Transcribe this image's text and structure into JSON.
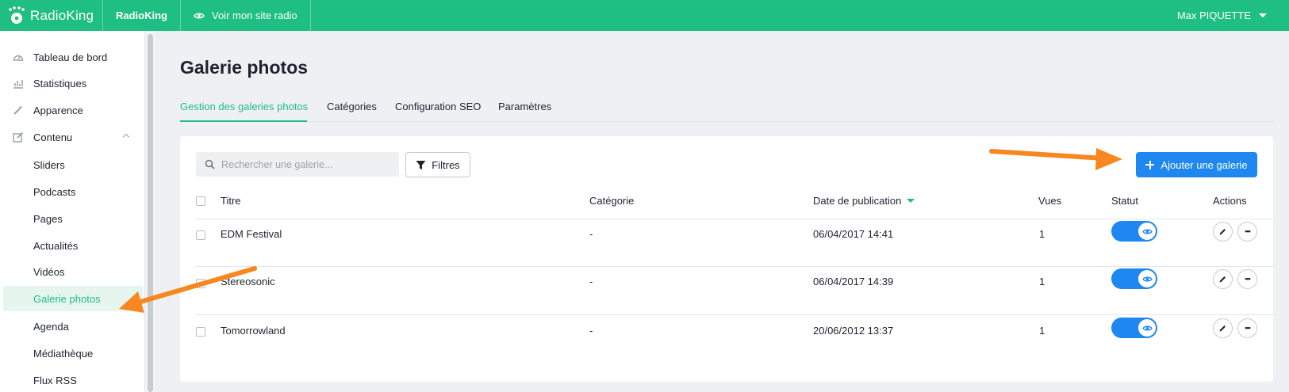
{
  "colors": {
    "brand": "#1fbe82",
    "primary": "#1e88f0",
    "annotation": "#f7871e"
  },
  "topbar": {
    "logo_text": "RadioKing",
    "station_name": "RadioKing",
    "view_site_label": "Voir mon site radio",
    "user_name": "Max PIQUETTE"
  },
  "sidebar": {
    "items": [
      {
        "label": "Tableau de bord",
        "icon": "gauge-icon"
      },
      {
        "label": "Statistiques",
        "icon": "bar-chart-icon"
      },
      {
        "label": "Apparence",
        "icon": "magic-wand-icon"
      },
      {
        "label": "Contenu",
        "icon": "edit-icon",
        "expanded": true
      },
      {
        "label": "Sliders"
      },
      {
        "label": "Podcasts"
      },
      {
        "label": "Pages"
      },
      {
        "label": "Actualités"
      },
      {
        "label": "Vidéos"
      },
      {
        "label": "Galerie photos",
        "active": true
      },
      {
        "label": "Agenda"
      },
      {
        "label": "Médiathèque"
      },
      {
        "label": "Flux RSS"
      }
    ]
  },
  "page": {
    "title": "Galerie photos"
  },
  "tabs": [
    {
      "label": "Gestion des galeries photos",
      "active": true
    },
    {
      "label": "Catégories"
    },
    {
      "label": "Configuration SEO"
    },
    {
      "label": "Paramètres"
    }
  ],
  "toolbar": {
    "search_placeholder": "Rechercher une galerie...",
    "filter_label": "Filtres",
    "add_label": "Ajouter une galerie"
  },
  "table": {
    "headers": {
      "title": "Titre",
      "category": "Catégorie",
      "date": "Date de publication",
      "views": "Vues",
      "status": "Statut",
      "actions": "Actions"
    },
    "sort": {
      "column": "date",
      "direction": "desc"
    },
    "rows": [
      {
        "title": "EDM Festival",
        "category": "-",
        "date": "06/04/2017 14:41",
        "views": "1",
        "published": true
      },
      {
        "title": "Stereosonic",
        "category": "-",
        "date": "06/04/2017 14:39",
        "views": "1",
        "published": true
      },
      {
        "title": "Tomorrowland",
        "category": "-",
        "date": "20/06/2012 13:37",
        "views": "1",
        "published": true
      }
    ]
  }
}
